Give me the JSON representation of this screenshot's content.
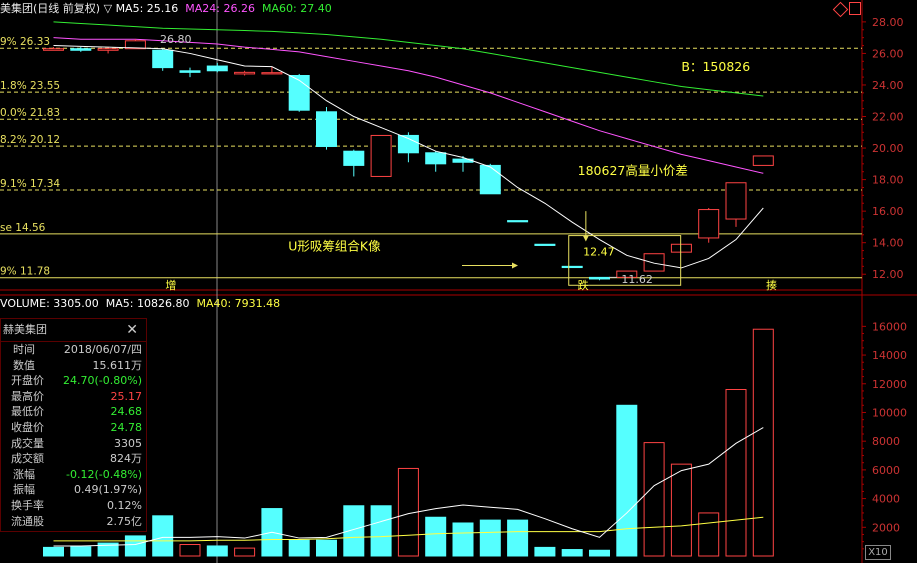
{
  "stock_name_header": "美集团(日线 前复权)",
  "ma_labels": [
    {
      "text": "MA5: 25.16",
      "color": "#ffffff"
    },
    {
      "text": "MA24: 26.26",
      "color": "#ff55ff"
    },
    {
      "text": "MA60: 27.40",
      "color": "#33ee33"
    }
  ],
  "volume_header": [
    {
      "text": "VOLUME: 3305.00",
      "color": "#ffffff"
    },
    {
      "text": "MA5: 10826.80",
      "color": "#ffffff"
    },
    {
      "text": "MA40: 7931.48",
      "color": "#ffff44"
    }
  ],
  "info_panel": {
    "title": "赫美集团",
    "close": "✕",
    "rows": [
      {
        "k": "时间",
        "v": "2018/06/07/四",
        "c": "#cccccc"
      },
      {
        "k": "数值",
        "v": "15.611万",
        "c": "#cccccc"
      },
      {
        "k": "开盘价",
        "v": "24.70(-0.80%)",
        "c": "#33ee33"
      },
      {
        "k": "最高价",
        "v": "25.17",
        "c": "#ff4444"
      },
      {
        "k": "最低价",
        "v": "24.68",
        "c": "#33ee33"
      },
      {
        "k": "收盘价",
        "v": "24.78",
        "c": "#33ee33"
      },
      {
        "k": "成交量",
        "v": "3305",
        "c": "#cccccc"
      },
      {
        "k": "成交额",
        "v": "824万",
        "c": "#cccccc"
      },
      {
        "k": "涨幅",
        "v": "-0.12(-0.48%)",
        "c": "#33ee33"
      },
      {
        "k": "振幅",
        "v": "0.49(1.97%)",
        "c": "#cccccc"
      },
      {
        "k": "换手率",
        "v": "0.12%",
        "c": "#cccccc"
      },
      {
        "k": "流通股",
        "v": "2.75亿",
        "c": "#cccccc"
      }
    ]
  },
  "top_right_icons": [
    "diamond-icon",
    "box-icon"
  ],
  "scale_badge": "X10",
  "chart_data": [
    {
      "type": "candlestick",
      "title": "美集团(日线 前复权)",
      "ylim": [
        11,
        28.5
      ],
      "y_ticks": [
        "28.00",
        "26.00",
        "24.00",
        "22.00",
        "20.00",
        "18.00",
        "16.00",
        "14.00",
        "12.00"
      ],
      "candles": [
        {
          "o": 26.2,
          "h": 26.4,
          "l": 26.2,
          "c": 26.3
        },
        {
          "o": 26.3,
          "h": 26.4,
          "l": 26.1,
          "c": 26.2
        },
        {
          "o": 26.2,
          "h": 26.4,
          "l": 26.0,
          "c": 26.3
        },
        {
          "o": 26.3,
          "h": 26.9,
          "l": 26.3,
          "c": 26.8
        },
        {
          "o": 26.2,
          "h": 26.3,
          "l": 24.9,
          "c": 25.1
        },
        {
          "o": 24.9,
          "h": 25.1,
          "l": 24.5,
          "c": 24.8
        },
        {
          "o": 25.2,
          "h": 25.4,
          "l": 24.8,
          "c": 24.9
        },
        {
          "o": 24.7,
          "h": 24.9,
          "l": 24.6,
          "c": 24.8
        },
        {
          "o": 24.7,
          "h": 25.17,
          "l": 24.68,
          "c": 24.78
        },
        {
          "o": 24.6,
          "h": 24.7,
          "l": 22.3,
          "c": 22.4
        },
        {
          "o": 22.3,
          "h": 22.6,
          "l": 19.9,
          "c": 20.1
        },
        {
          "o": 19.8,
          "h": 19.9,
          "l": 18.2,
          "c": 18.9
        },
        {
          "o": 18.2,
          "h": 20.8,
          "l": 18.2,
          "c": 20.8
        },
        {
          "o": 20.8,
          "h": 21.0,
          "l": 19.1,
          "c": 19.7
        },
        {
          "o": 19.7,
          "h": 19.8,
          "l": 18.5,
          "c": 19.0
        },
        {
          "o": 19.3,
          "h": 19.5,
          "l": 18.5,
          "c": 19.1
        },
        {
          "o": 18.9,
          "h": 19.0,
          "l": 17.1,
          "c": 17.1
        },
        {
          "o": 15.4,
          "h": 15.4,
          "l": 15.4,
          "c": 15.4
        },
        {
          "o": 13.9,
          "h": 13.9,
          "l": 13.9,
          "c": 13.9
        },
        {
          "o": 12.5,
          "h": 12.5,
          "l": 12.5,
          "c": 12.5
        },
        {
          "o": 11.8,
          "h": 11.8,
          "l": 11.62,
          "c": 11.7
        },
        {
          "o": 11.8,
          "h": 12.2,
          "l": 11.8,
          "c": 12.2
        },
        {
          "o": 12.2,
          "h": 13.3,
          "l": 12.2,
          "c": 13.3
        },
        {
          "o": 13.4,
          "h": 13.9,
          "l": 13.4,
          "c": 13.9
        },
        {
          "o": 14.3,
          "h": 16.2,
          "l": 14.0,
          "c": 16.1
        },
        {
          "o": 15.5,
          "h": 17.8,
          "l": 15.0,
          "c": 17.8
        },
        {
          "o": 18.9,
          "h": 19.5,
          "l": 18.9,
          "c": 19.5
        }
      ],
      "ma5": [
        26.5,
        26.45,
        26.4,
        26.35,
        26.3,
        26.0,
        25.6,
        25.2,
        25.16,
        24.3,
        23.0,
        22.0,
        21.3,
        20.6,
        19.8,
        19.4,
        18.8,
        17.5,
        16.5,
        15.3,
        14.2,
        13.2,
        12.7,
        12.4,
        13.0,
        14.2,
        16.2
      ],
      "ma24": [
        27.0,
        26.9,
        26.9,
        26.9,
        26.8,
        26.7,
        26.6,
        26.4,
        26.26,
        26.1,
        25.8,
        25.5,
        25.2,
        24.9,
        24.5,
        24.0,
        23.5,
        22.9,
        22.3,
        21.7,
        21.1,
        20.6,
        20.1,
        19.6,
        19.2,
        18.8,
        18.4
      ],
      "ma60": [
        28.0,
        27.9,
        27.8,
        27.7,
        27.6,
        27.55,
        27.5,
        27.45,
        27.4,
        27.3,
        27.2,
        27.05,
        26.9,
        26.7,
        26.5,
        26.3,
        26.0,
        25.7,
        25.4,
        25.1,
        24.8,
        24.5,
        24.2,
        23.9,
        23.7,
        23.5,
        23.3
      ],
      "h_levels": [
        {
          "y": 26.33,
          "label": "9% 26.33",
          "style": "dashed"
        },
        {
          "y": 23.55,
          "label": "1.8% 23.55",
          "style": "dashed"
        },
        {
          "y": 21.83,
          "label": "0.0% 21.83",
          "style": "dashed"
        },
        {
          "y": 20.12,
          "label": "8.2% 20.12",
          "style": "dashed"
        },
        {
          "y": 17.34,
          "label": "9.1% 17.34",
          "style": "dashed"
        },
        {
          "y": 14.56,
          "label": "se 14.56",
          "style": "solid"
        },
        {
          "y": 11.78,
          "label": "9% 11.78",
          "style": "solid"
        }
      ],
      "annotations": [
        {
          "text": "26.80",
          "x_index": 3.9,
          "y": 26.65,
          "color": "#cccccc"
        },
        {
          "text": "B：150826",
          "x_index": 23.0,
          "y": 24.9,
          "color": "#ffff44"
        },
        {
          "text": "180627高量小价差",
          "x_index": 19.2,
          "y": 18.3,
          "color": "#ffff44"
        },
        {
          "text": "U形吸筹组合K像",
          "x_index": 8.6,
          "y": 13.5,
          "color": "#ffff44"
        },
        {
          "text": "12.47",
          "x_index": 19.4,
          "y": 13.2,
          "color": "#ffff44"
        },
        {
          "text": "11.62",
          "x_index": 20.8,
          "y": 11.45,
          "color": "#cccccc"
        }
      ],
      "bottom_markers": [
        {
          "text": "增",
          "x_index": 4.3
        },
        {
          "text": "跌",
          "x_index": 19.4
        },
        {
          "text": "揍",
          "x_index": 26.3
        }
      ]
    },
    {
      "type": "bar",
      "title": "VOLUME",
      "ylim": [
        0,
        17000
      ],
      "y_ticks": [
        "16000",
        "14000",
        "12000",
        "10000",
        "8000",
        "6000",
        "4000",
        "2000"
      ],
      "values": [
        600,
        650,
        900,
        1400,
        2800,
        800,
        700,
        550,
        3305,
        1100,
        1100,
        3500,
        3500,
        6100,
        2700,
        2300,
        2500,
        2500,
        600,
        450,
        400,
        10500,
        7900,
        6400,
        3000,
        11600,
        15800
      ],
      "up": [
        false,
        false,
        false,
        false,
        false,
        true,
        false,
        true,
        false,
        false,
        false,
        false,
        false,
        true,
        false,
        false,
        false,
        false,
        false,
        false,
        false,
        false,
        true,
        true,
        true,
        true,
        true
      ],
      "ma5": [
        700,
        700,
        750,
        800,
        1300,
        1300,
        1350,
        1250,
        1650,
        1250,
        1300,
        1850,
        2400,
        2950,
        3300,
        3550,
        3400,
        3250,
        2600,
        1900,
        1300,
        3000,
        4900,
        5950,
        6400,
        7850,
        8950
      ],
      "ma40": [
        1050,
        1050,
        1050,
        1050,
        1050,
        1050,
        1100,
        1100,
        1150,
        1150,
        1200,
        1300,
        1350,
        1450,
        1550,
        1600,
        1650,
        1700,
        1700,
        1700,
        1700,
        1900,
        2000,
        2100,
        2300,
        2500,
        2700
      ]
    }
  ]
}
